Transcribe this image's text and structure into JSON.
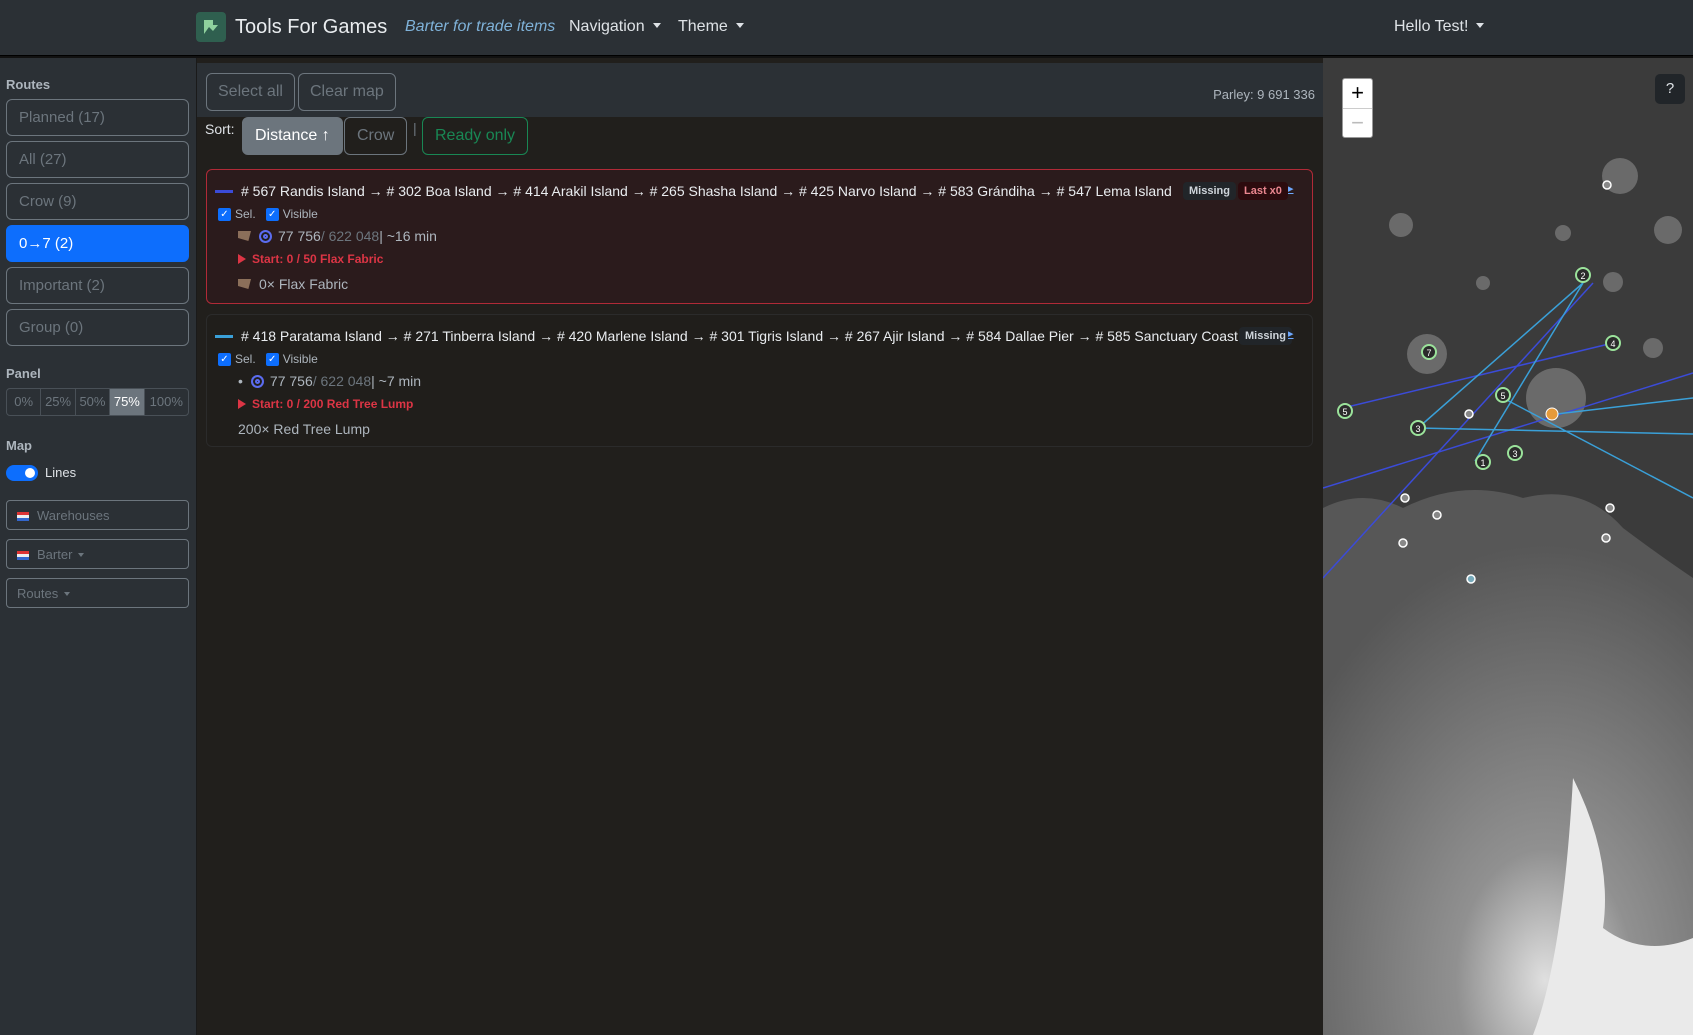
{
  "navbar": {
    "brand": "Tools For Games",
    "barter_link": "Barter for trade items",
    "navigation": "Navigation",
    "theme": "Theme",
    "user": "Hello Test!"
  },
  "sidebar": {
    "routes_label": "Routes",
    "routes": [
      {
        "label": "Planned (17)",
        "active": false
      },
      {
        "label": "All (27)",
        "active": false
      },
      {
        "label": "Crow (9)",
        "active": false
      },
      {
        "label": "0→7 (2)",
        "active": true
      },
      {
        "label": "Important (2)",
        "active": false
      },
      {
        "label": "Group (0)",
        "active": false
      }
    ],
    "panel_label": "Panel",
    "panel_options": [
      "0%",
      "25%",
      "50%",
      "75%",
      "100%"
    ],
    "panel_selected": "75%",
    "map_label": "Map",
    "lines_label": "Lines",
    "lines_on": true,
    "warehouses": "Warehouses",
    "barter": "Barter",
    "routes_dropdown": "Routes"
  },
  "toolbar": {
    "select_all": "Select all",
    "clear_map": "Clear map",
    "parley": "Parley: 9 691 336"
  },
  "sort": {
    "label": "Sort:",
    "distance": "Distance ↑",
    "crow": "Crow",
    "pipe": "|",
    "ready_only": "Ready only"
  },
  "cards": [
    {
      "route": "# 567 Randis Island → # 302 Boa Island → # 414 Arakil Island → # 265 Shasha Island → # 425 Narvo Island → # 583 Grándiha → # 547 Lema Island",
      "missing": "Missing",
      "last": "Last x0",
      "arrow": "▸",
      "sel": "Sel.",
      "visible": "Visible",
      "stat_value": "77 756",
      "stat_max": " / 622 048",
      "stat_time": " | ~16 min",
      "start": "Start: 0 / 50 Flax Fabric",
      "item": "0× Flax Fabric",
      "color": "#3b4bd8"
    },
    {
      "route": "# 418 Paratama Island → # 271 Tinberra Island → # 420 Marlene Island → # 301 Tigris Island → # 267 Ajir Island → # 584 Dallae Pier → # 585 Sanctuary Coast...",
      "missing": "Missing",
      "arrow": "▸",
      "sel": "Sel.",
      "visible": "Visible",
      "bullet": "•",
      "stat_value": "77 756",
      "stat_max": " / 622 048",
      "stat_time": " | ~7 min",
      "start": "Start: 0 / 200 Red Tree Lump",
      "item": "200× Red Tree Lump",
      "color": "#3aa0d8"
    }
  ],
  "map": {
    "zoom_in": "+",
    "zoom_out": "−",
    "help": "?",
    "markers": [
      "2",
      "7",
      "4",
      "5",
      "5",
      "3",
      "1",
      "3"
    ]
  }
}
